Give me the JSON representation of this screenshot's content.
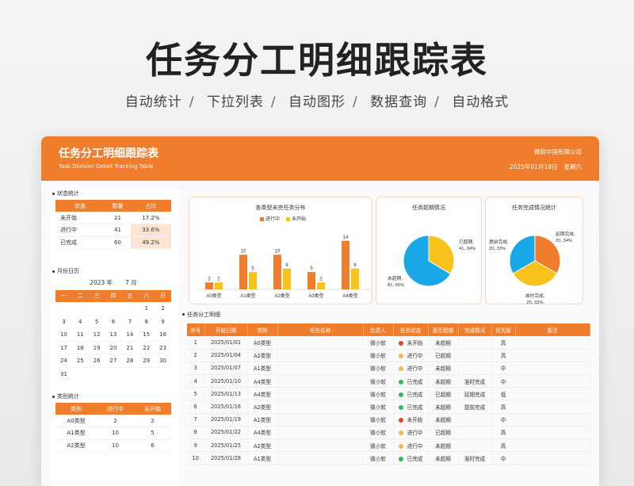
{
  "hero": {
    "title": "任务分工明细跟踪表",
    "features": [
      "自动统计",
      "下拉列表",
      "自动图形",
      "数据查询",
      "自动格式"
    ]
  },
  "sheet": {
    "title": "任务分工明细跟踪表",
    "subtitle_en": "Task Division Detail Tracking Table",
    "company": "微软中国有限公司",
    "date": "2025年01月18日",
    "weekday": "星期六"
  },
  "status_stats": {
    "label": "状态统计",
    "headers": [
      "状态",
      "数量",
      "占比"
    ],
    "rows": [
      {
        "status": "未开始",
        "count": "21",
        "pct": "17.2%"
      },
      {
        "status": "进行中",
        "count": "41",
        "pct": "33.6%"
      },
      {
        "status": "已完成",
        "count": "60",
        "pct": "49.2%"
      }
    ]
  },
  "calendar": {
    "label": "月份日历",
    "year": "2023 年",
    "month": "7 月",
    "weekdays": [
      "一",
      "二",
      "三",
      "四",
      "五",
      "六",
      "日"
    ],
    "days": [
      "",
      "",
      "",
      "",
      "",
      "1",
      "2",
      "3",
      "4",
      "5",
      "6",
      "7",
      "8",
      "9",
      "10",
      "11",
      "12",
      "13",
      "14",
      "15",
      "16",
      "17",
      "18",
      "19",
      "20",
      "21",
      "22",
      "23",
      "24",
      "25",
      "26",
      "27",
      "28",
      "29",
      "30",
      "31"
    ]
  },
  "category_stats": {
    "label": "类别统计",
    "headers": [
      "类别",
      "进行中",
      "未开始"
    ],
    "rows": [
      {
        "cat": "A0类型",
        "doing": "2",
        "todo": "2"
      },
      {
        "cat": "A1类型",
        "doing": "10",
        "todo": "5"
      },
      {
        "cat": "A2类型",
        "doing": "10",
        "todo": "6"
      }
    ]
  },
  "bar_chart": {
    "title": "各类型未完任务分布",
    "chart_data": {
      "type": "bar",
      "title": "各类型未完任务分布",
      "categories": [
        "A0类型",
        "A1类型",
        "A2类型",
        "A3类型",
        "A4类型"
      ],
      "series": [
        {
          "name": "进行中",
          "values": [
            2,
            10,
            10,
            5,
            14
          ],
          "color": "#ef7d2c"
        },
        {
          "name": "未开始",
          "values": [
            2,
            5,
            6,
            2,
            6
          ],
          "color": "#f8c21a"
        }
      ],
      "ylim": [
        0,
        16
      ],
      "legend": "top"
    }
  },
  "pie_overdue": {
    "title": "任务超期情况",
    "chart_data": {
      "type": "pie",
      "title": "任务超期情况",
      "slices": [
        {
          "label": "已超期",
          "value": 41,
          "pct": "34%",
          "text": "已超期,\n41, 34%",
          "color": "#f8c21a"
        },
        {
          "label": "未超期",
          "value": 81,
          "pct": "66%",
          "text": "未超期,\n81, 66%",
          "color": "#1aa7e8"
        }
      ]
    }
  },
  "pie_completion": {
    "title": "任务完成情况统计",
    "chart_data": {
      "type": "pie",
      "title": "任务完成情况统计",
      "slices": [
        {
          "label": "延期完成",
          "value": 20,
          "pct": "34%",
          "text": "延期完成,\n20, 34%",
          "color": "#ef7d2c"
        },
        {
          "label": "准时完成",
          "value": 20,
          "pct": "33%",
          "text": "准时完成,\n20, 33%",
          "color": "#f8c21a"
        },
        {
          "label": "提前完成",
          "value": 20,
          "pct": "33%",
          "text": "提前完成,\n20, 33%",
          "color": "#1aa7e8"
        }
      ]
    }
  },
  "detail": {
    "label": "任务分工明细",
    "headers": [
      "序号",
      "开始日期",
      "类别",
      "任务名称",
      "负责人",
      "任务状态",
      "是否超期",
      "完成情况",
      "优先级",
      "备注"
    ],
    "rows": [
      {
        "no": "1",
        "date": "2025/01/01",
        "cat": "A0类型",
        "name": "",
        "owner": "微小软",
        "status": "未开始",
        "st": "red",
        "overdue": "未超期",
        "done": "",
        "prio": "高",
        "note": ""
      },
      {
        "no": "2",
        "date": "2025/01/04",
        "cat": "A2类型",
        "name": "",
        "owner": "微小软",
        "status": "进行中",
        "st": "yellow",
        "overdue": "已超期",
        "done": "",
        "prio": "高",
        "note": ""
      },
      {
        "no": "3",
        "date": "2025/01/07",
        "cat": "A1类型",
        "name": "",
        "owner": "微小软",
        "status": "进行中",
        "st": "yellow",
        "overdue": "未超期",
        "done": "",
        "prio": "中",
        "note": ""
      },
      {
        "no": "4",
        "date": "2025/01/10",
        "cat": "A4类型",
        "name": "",
        "owner": "微小软",
        "status": "已完成",
        "st": "green",
        "overdue": "未超期",
        "done": "准时完成",
        "prio": "中",
        "note": ""
      },
      {
        "no": "5",
        "date": "2025/01/13",
        "cat": "A4类型",
        "name": "",
        "owner": "微小软",
        "status": "已完成",
        "st": "green",
        "overdue": "已超期",
        "done": "延期完成",
        "prio": "低",
        "note": ""
      },
      {
        "no": "6",
        "date": "2025/01/16",
        "cat": "A2类型",
        "name": "",
        "owner": "微小软",
        "status": "已完成",
        "st": "green",
        "overdue": "未超期",
        "done": "提前完成",
        "prio": "高",
        "note": ""
      },
      {
        "no": "7",
        "date": "2025/01/19",
        "cat": "A1类型",
        "name": "",
        "owner": "微小软",
        "status": "未开始",
        "st": "red",
        "overdue": "未超期",
        "done": "",
        "prio": "中",
        "note": ""
      },
      {
        "no": "8",
        "date": "2025/01/22",
        "cat": "A4类型",
        "name": "",
        "owner": "微小软",
        "status": "进行中",
        "st": "yellow",
        "overdue": "已超期",
        "done": "",
        "prio": "高",
        "note": ""
      },
      {
        "no": "9",
        "date": "2025/01/25",
        "cat": "A2类型",
        "name": "",
        "owner": "微小软",
        "status": "进行中",
        "st": "yellow",
        "overdue": "未超期",
        "done": "",
        "prio": "高",
        "note": ""
      },
      {
        "no": "10",
        "date": "2025/01/28",
        "cat": "A1类型",
        "name": "",
        "owner": "微小软",
        "status": "已完成",
        "st": "green",
        "overdue": "未超期",
        "done": "准时完成",
        "prio": "中",
        "note": ""
      }
    ]
  }
}
